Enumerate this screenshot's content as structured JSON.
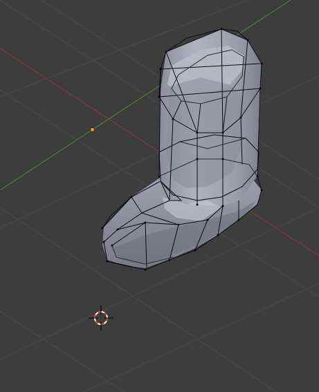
{
  "viewport": {
    "background": "#3d3d3d",
    "grid_color": "#4a4a4a",
    "x_axis_color": "#8b3a3a",
    "y_axis_color": "#4e8a3c"
  },
  "mesh": {
    "fill": "#9fa0ae",
    "wire_color": "#0b0b0b",
    "vertex_color": "#000000"
  },
  "origin_dot": {
    "color": "#f0a51e",
    "icon": "object-origin-icon"
  },
  "cursor": {
    "icon": "3d-cursor-icon",
    "ring_primary": "#d33a2c",
    "ring_secondary": "#ffffff",
    "crosshair": "#000000"
  }
}
